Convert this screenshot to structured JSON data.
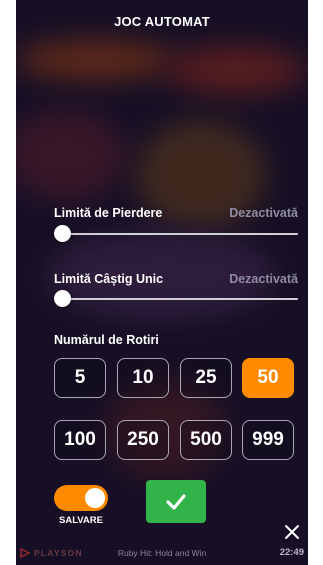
{
  "modal": {
    "title": "JOC AUTOMAT",
    "loss_limit": {
      "label": "Limită de Pierdere",
      "value": "Dezactivată",
      "level": 0
    },
    "single_win_limit": {
      "label": "Limită Câștig Unic",
      "value": "Dezactivată",
      "level": 0
    },
    "spins": {
      "label": "Numărul de Rotiri",
      "options": [
        "5",
        "10",
        "25",
        "50",
        "100",
        "250",
        "500",
        "999"
      ],
      "selected": "50"
    },
    "save_toggle": {
      "label": "SALVARE",
      "on": true
    },
    "confirm_icon": "checkmark-icon",
    "close_icon": "close-icon"
  },
  "footer": {
    "brand": "PLAYSON",
    "game_name": "Ruby Hit: Hold and Win",
    "time": "22:49"
  },
  "colors": {
    "accent": "#ff8a00",
    "confirm": "#32b34a",
    "overlay": "#1e1631"
  }
}
